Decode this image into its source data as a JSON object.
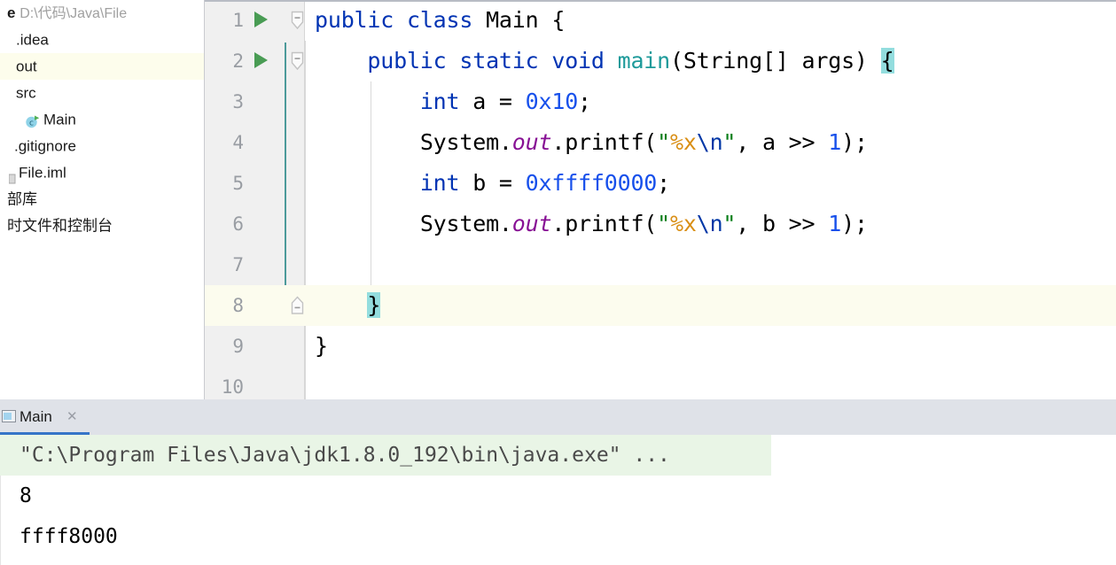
{
  "project_panel": {
    "items": [
      {
        "icon": "folder-stub-icon",
        "stub": "e",
        "label": "",
        "path": "D:\\代码\\Java\\File",
        "selected": false,
        "indent": 0
      },
      {
        "icon": "folder-icon",
        "stub": "",
        "label": ".idea",
        "path": "",
        "selected": false,
        "indent": 1
      },
      {
        "icon": "folder-icon",
        "stub": "",
        "label": "out",
        "path": "",
        "selected": true,
        "indent": 1
      },
      {
        "icon": "folder-icon",
        "stub": "",
        "label": "src",
        "path": "",
        "selected": false,
        "indent": 1
      },
      {
        "icon": "java-class-icon",
        "stub": "",
        "label": "Main",
        "path": "",
        "selected": false,
        "indent": 2
      },
      {
        "icon": "file-icon",
        "stub": "",
        "label": ".gitignore",
        "path": "",
        "selected": false,
        "indent": 1
      },
      {
        "icon": "iml-file-icon",
        "stub": "",
        "label": "File.iml",
        "path": "",
        "selected": false,
        "indent": 1
      },
      {
        "icon": "library-icon",
        "stub": "",
        "label": "部库",
        "path": "",
        "selected": false,
        "indent": 0
      },
      {
        "icon": "scratches-icon",
        "stub": "",
        "label": "时文件和控制台",
        "path": "",
        "selected": false,
        "indent": 0
      }
    ]
  },
  "editor": {
    "lines": [
      {
        "number": "1",
        "run_arrow": true,
        "fold": "open-top",
        "current": false,
        "tokens": [
          {
            "t": "public ",
            "c": "kw"
          },
          {
            "t": "class ",
            "c": "kw"
          },
          {
            "t": "Main",
            "c": "plain"
          },
          {
            "t": " {",
            "c": "plain"
          }
        ]
      },
      {
        "number": "2",
        "run_arrow": true,
        "fold": "open",
        "current": false,
        "tokens": [
          {
            "t": "    ",
            "c": "plain"
          },
          {
            "t": "public ",
            "c": "kw"
          },
          {
            "t": "static ",
            "c": "kw"
          },
          {
            "t": "void ",
            "c": "kw"
          },
          {
            "t": "main",
            "c": "mname"
          },
          {
            "t": "(String[] args) ",
            "c": "plain"
          },
          {
            "t": "{",
            "c": "brace-hl"
          }
        ]
      },
      {
        "number": "3",
        "run_arrow": false,
        "fold": "",
        "current": false,
        "tokens": [
          {
            "t": "        ",
            "c": "plain"
          },
          {
            "t": "int",
            "c": "kw"
          },
          {
            "t": " a = ",
            "c": "plain"
          },
          {
            "t": "0x10",
            "c": "num"
          },
          {
            "t": ";",
            "c": "plain"
          }
        ]
      },
      {
        "number": "4",
        "run_arrow": false,
        "fold": "",
        "current": false,
        "tokens": [
          {
            "t": "        ",
            "c": "plain"
          },
          {
            "t": "System.",
            "c": "plain"
          },
          {
            "t": "out",
            "c": "stat"
          },
          {
            "t": ".printf(",
            "c": "plain"
          },
          {
            "t": "\"",
            "c": "str"
          },
          {
            "t": "%x",
            "c": "fmt"
          },
          {
            "t": "\\n",
            "c": "esc"
          },
          {
            "t": "\"",
            "c": "str"
          },
          {
            "t": ", a >> ",
            "c": "plain"
          },
          {
            "t": "1",
            "c": "num"
          },
          {
            "t": ");",
            "c": "plain"
          }
        ]
      },
      {
        "number": "5",
        "run_arrow": false,
        "fold": "",
        "current": false,
        "tokens": [
          {
            "t": "        ",
            "c": "plain"
          },
          {
            "t": "int",
            "c": "kw"
          },
          {
            "t": " b = ",
            "c": "plain"
          },
          {
            "t": "0xffff0000",
            "c": "num"
          },
          {
            "t": ";",
            "c": "plain"
          }
        ]
      },
      {
        "number": "6",
        "run_arrow": false,
        "fold": "",
        "current": false,
        "tokens": [
          {
            "t": "        ",
            "c": "plain"
          },
          {
            "t": "System.",
            "c": "plain"
          },
          {
            "t": "out",
            "c": "stat"
          },
          {
            "t": ".printf(",
            "c": "plain"
          },
          {
            "t": "\"",
            "c": "str"
          },
          {
            "t": "%x",
            "c": "fmt"
          },
          {
            "t": "\\n",
            "c": "esc"
          },
          {
            "t": "\"",
            "c": "str"
          },
          {
            "t": ", b >> ",
            "c": "plain"
          },
          {
            "t": "1",
            "c": "num"
          },
          {
            "t": ");",
            "c": "plain"
          }
        ]
      },
      {
        "number": "7",
        "run_arrow": false,
        "fold": "",
        "current": false,
        "tokens": []
      },
      {
        "number": "8",
        "run_arrow": false,
        "fold": "close",
        "current": true,
        "tokens": [
          {
            "t": "    ",
            "c": "plain"
          },
          {
            "t": "}",
            "c": "brace-hl"
          }
        ]
      },
      {
        "number": "9",
        "run_arrow": false,
        "fold": "",
        "current": false,
        "tokens": [
          {
            "t": "}",
            "c": "plain"
          }
        ]
      },
      {
        "number": "10",
        "run_arrow": false,
        "fold": "",
        "current": false,
        "tokens": []
      }
    ]
  },
  "console": {
    "tab_label": "Main",
    "close_glyph": "✕",
    "lines": [
      {
        "text": "\"C:\\Program Files\\Java\\jdk1.8.0_192\\bin\\java.exe\" ...",
        "kind": "cmd"
      },
      {
        "text": "8",
        "kind": "out"
      },
      {
        "text": "ffff8000",
        "kind": "out"
      }
    ]
  },
  "colors": {
    "keyword": "#0033b3",
    "number": "#1750eb",
    "string": "#067d17",
    "format": "#d98f16",
    "escape": "#0037a6",
    "static_field": "#871094",
    "method_name": "#1d9a9a",
    "brace_match": "#93ddde",
    "current_line": "#fcfcee",
    "selection": "#fdfdec",
    "run_arrow": "#499c54",
    "tab_underline": "#3675c8",
    "console_cmd_bg": "#e9f5e6"
  }
}
